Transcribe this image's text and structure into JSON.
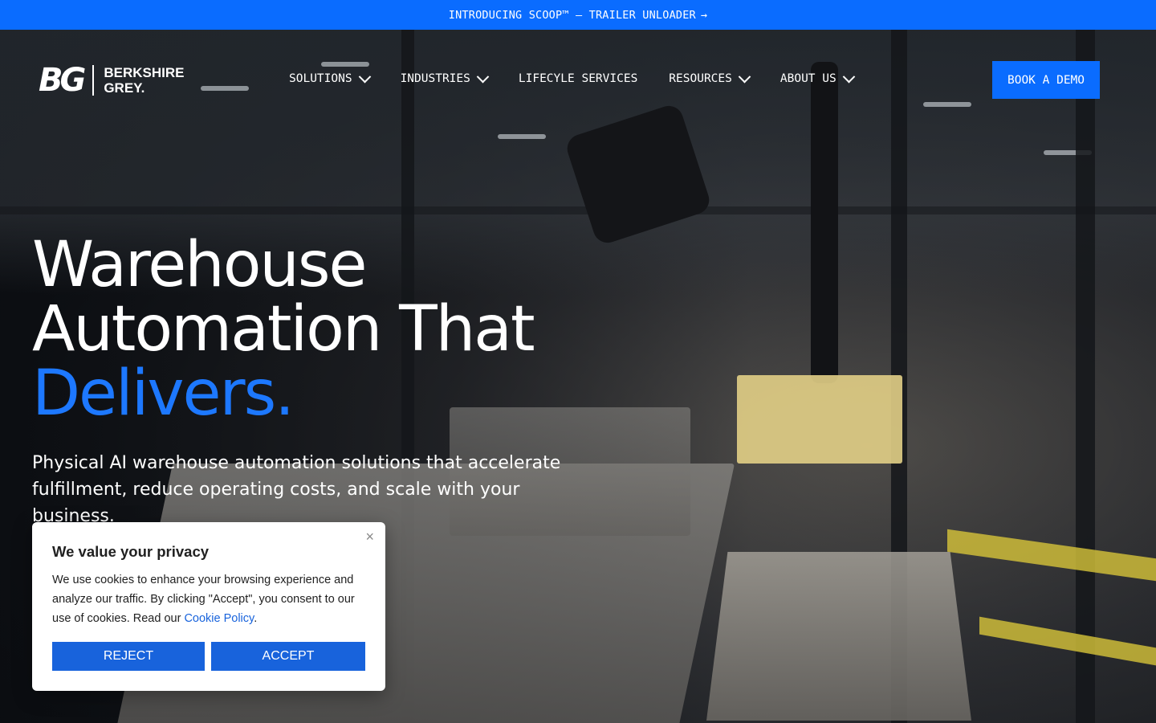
{
  "announcement": {
    "text": "INTRODUCING SCOOP™ – TRAILER UNLOADER",
    "arrow": "→"
  },
  "brand": {
    "mark": "BG",
    "name_line1": "BERKSHIRE",
    "name_line2": "GREY."
  },
  "nav": {
    "items": [
      {
        "label": "SOLUTIONS",
        "dropdown": true
      },
      {
        "label": "INDUSTRIES",
        "dropdown": true
      },
      {
        "label": "LIFECYLE SERVICES",
        "dropdown": false
      },
      {
        "label": "RESOURCES",
        "dropdown": true
      },
      {
        "label": "ABOUT US",
        "dropdown": true
      }
    ],
    "cta_label": "BOOK A DEMO"
  },
  "hero": {
    "line1": "Warehouse",
    "line2": "Automation That",
    "line3": "Delivers.",
    "subtitle": "Physical AI warehouse automation solutions that accelerate fulfillment, reduce operating costs, and scale with your business."
  },
  "cookie_banner": {
    "title": "We value your privacy",
    "body_prefix": "We use cookies to enhance your browsing experience and analyze our traffic. By clicking \"Accept\", you consent to our use of cookies. Read our ",
    "link_text": "Cookie Policy",
    "body_suffix": ".",
    "close_glyph": "×",
    "reject_label": "REJECT",
    "accept_label": "ACCEPT"
  },
  "colors": {
    "accent": "#0a6cff",
    "cookie_button": "#1863dc",
    "headline_accent": "#1d78ff"
  }
}
